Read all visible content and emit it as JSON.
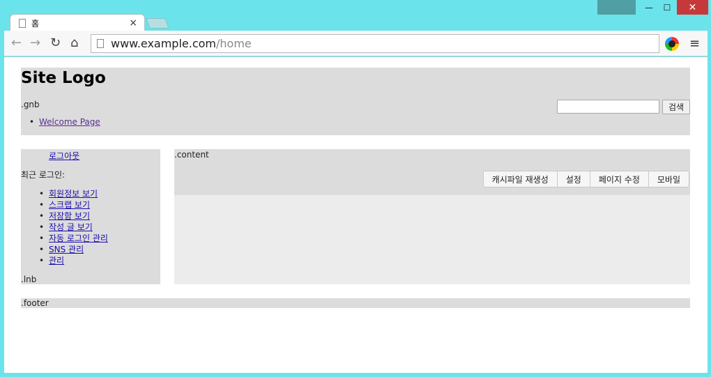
{
  "browser": {
    "tab_title": "홈",
    "tab_close": "×",
    "url_host": "www.example.com",
    "url_path": "/home",
    "window_controls": {
      "minimize": "—",
      "maximize": "☐",
      "close": "✕"
    }
  },
  "header": {
    "logo": "Site Logo",
    "gnb_label": ".gnb",
    "gnb_items": [
      "Welcome Page"
    ],
    "search_button": "검색",
    "search_value": ""
  },
  "lnb": {
    "logout": "로그아웃",
    "recent_login": "최근 로그인:",
    "items": [
      "회원정보 보기",
      "스크랩 보기",
      "저장함 보기",
      "작성 글 보기",
      "자동 로그인 관리",
      "SNS 관리",
      "관리"
    ],
    "label": ".lnb"
  },
  "content": {
    "label": ".content",
    "buttons": [
      "캐시파일 재생성",
      "설정",
      "페이지 수정",
      "모바일"
    ]
  },
  "footer": {
    "label": ".footer"
  },
  "colors": {
    "browser_frame": "#6be3ea",
    "section_bg": "#dcdcdc",
    "content_bg": "#ececec",
    "close_button": "#c7383a"
  }
}
